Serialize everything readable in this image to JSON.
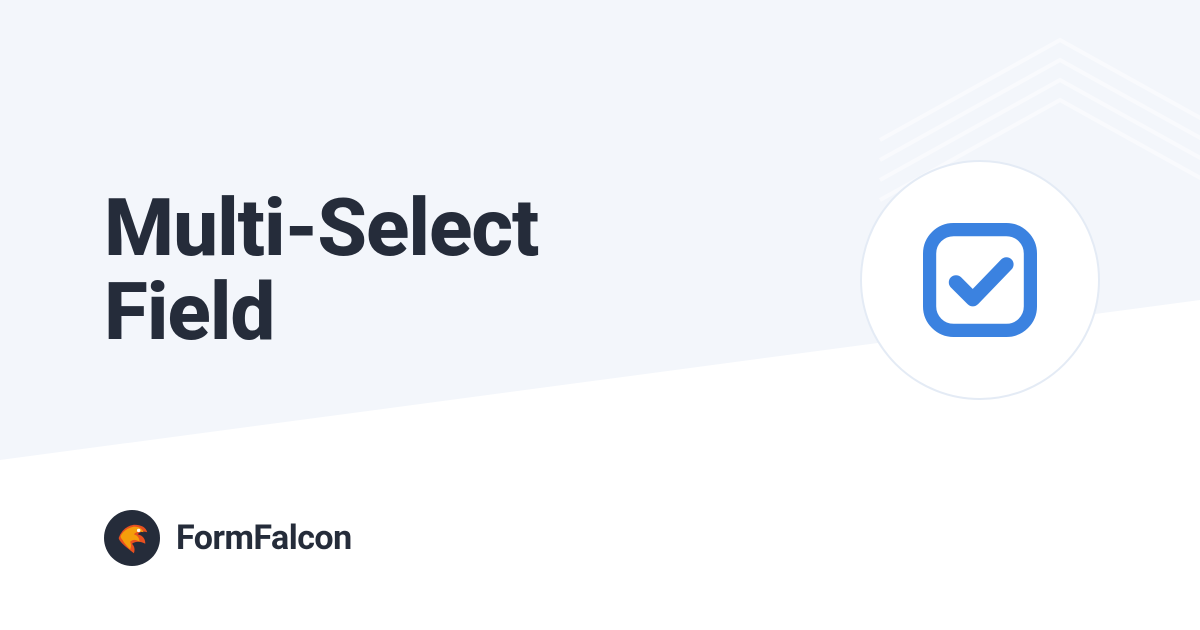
{
  "hero": {
    "title_line1": "Multi-Select",
    "title_line2": "Field"
  },
  "brand": {
    "name": "FormFalcon"
  },
  "icon": {
    "name": "checkbox-checked-icon",
    "color": "#3b82e0"
  }
}
